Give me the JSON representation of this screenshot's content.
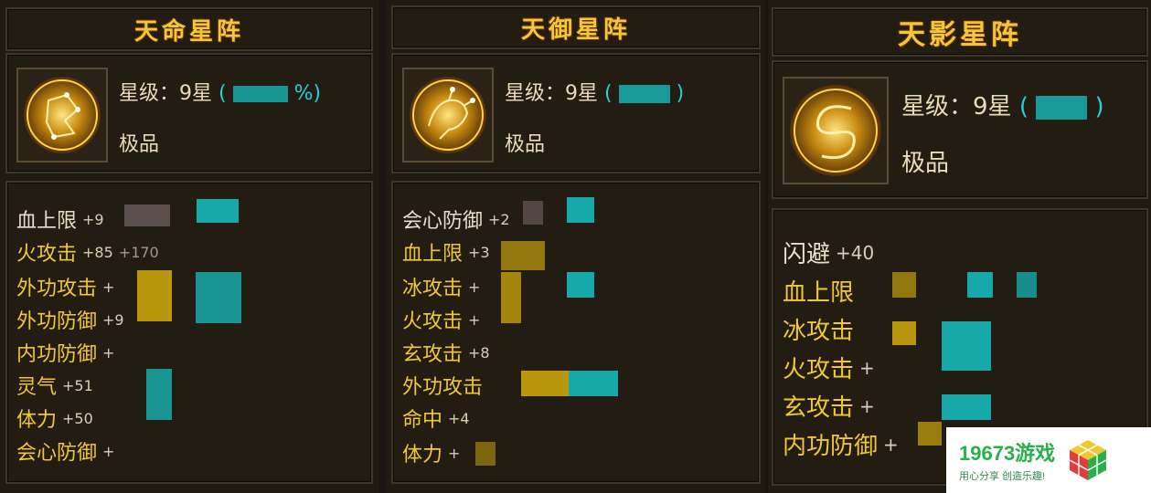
{
  "panels": [
    {
      "title": "天命星阵",
      "level_label": "星级：9星",
      "level_paren_open": "(",
      "level_paren_close": "%)",
      "quality": "极品",
      "stats": [
        {
          "name": "血上限",
          "value": "+9"
        },
        {
          "name": "火攻击",
          "value": "+85"
        },
        {
          "name": "外功攻击",
          "value": "+"
        },
        {
          "name": "外功防御",
          "value": "+9"
        },
        {
          "name": "内功防御",
          "value": "+"
        },
        {
          "name": "灵气",
          "value": "+51"
        },
        {
          "name": "体力",
          "value": "+50"
        },
        {
          "name": "会心防御",
          "value": "+"
        }
      ],
      "extra_fragment": "+170"
    },
    {
      "title": "天御星阵",
      "level_label": "星级：9星",
      "level_paren_open": "(",
      "level_paren_close": ")",
      "quality": "极品",
      "stats": [
        {
          "name": "会心防御",
          "value": "+2"
        },
        {
          "name": "血上限",
          "value": "+3"
        },
        {
          "name": "冰攻击",
          "value": "+"
        },
        {
          "name": "火攻击",
          "value": "+"
        },
        {
          "name": "玄攻击",
          "value": "+8"
        },
        {
          "name": "外功攻击",
          "value": ""
        },
        {
          "name": "命中",
          "value": "+4"
        },
        {
          "name": "体力",
          "value": "+"
        }
      ]
    },
    {
      "title": "天影星阵",
      "level_label": "星级：9星",
      "level_paren_open": "(",
      "level_paren_close": ")",
      "quality": "极品",
      "stats": [
        {
          "name": "闪避",
          "value": "+40"
        },
        {
          "name": "血上限",
          "value": ""
        },
        {
          "name": "冰攻击",
          "value": ""
        },
        {
          "name": "火攻击",
          "value": "+"
        },
        {
          "name": "玄攻击",
          "value": "+"
        },
        {
          "name": "内功防御",
          "value": "+"
        }
      ]
    }
  ],
  "watermark": {
    "main": "19673游戏",
    "sub": "用心分享 创造乐趣!"
  },
  "colors": {
    "gold": "#f0c832",
    "cyan": "#22d0d8",
    "mosaic_gold": "#b8960e",
    "mosaic_teal": "#17a9a9"
  }
}
